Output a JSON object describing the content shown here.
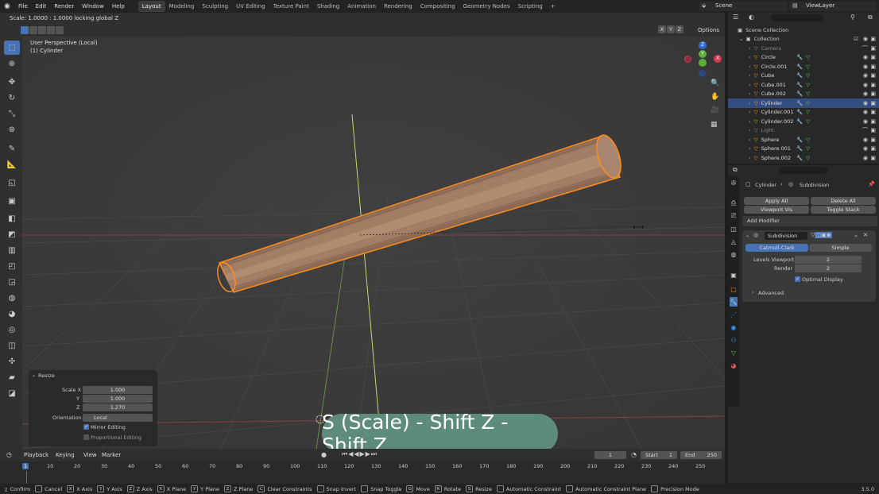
{
  "menu": [
    "File",
    "Edit",
    "Render",
    "Window",
    "Help"
  ],
  "workspaces": [
    "Layout",
    "Modeling",
    "Sculpting",
    "UV Editing",
    "Texture Paint",
    "Shading",
    "Animation",
    "Rendering",
    "Compositing",
    "Geometry Nodes",
    "Scripting"
  ],
  "add_workspace": "+",
  "scene": "Scene",
  "view_layer": "ViewLayer",
  "header_info": "Scale: 1.0000 : 1.0000 locking global Z",
  "axis_buttons": [
    "X",
    "Y",
    "Z"
  ],
  "options_label": "Options",
  "viewport": {
    "perspective": "User Perspective (Local)",
    "object": "(1) Cylinder"
  },
  "gizmo": {
    "z": "Z",
    "y": "Y",
    "x": "X"
  },
  "outliner": {
    "search_placeholder": "",
    "scene_collection": "Scene Collection",
    "collection": "Collection",
    "items": [
      {
        "name": "Camera",
        "dim": true
      },
      {
        "name": "Circle",
        "dim": false
      },
      {
        "name": "Circle.001",
        "dim": false
      },
      {
        "name": "Cube",
        "dim": false
      },
      {
        "name": "Cube.001",
        "dim": false
      },
      {
        "name": "Cube.002",
        "dim": false
      },
      {
        "name": "Cylinder",
        "dim": false,
        "selected": true
      },
      {
        "name": "Cylinder.001",
        "dim": false
      },
      {
        "name": "Cylinder.002",
        "dim": false
      },
      {
        "name": "Light",
        "dim": true
      },
      {
        "name": "Sphere",
        "dim": false
      },
      {
        "name": "Sphere.001",
        "dim": false
      },
      {
        "name": "Sphere.002",
        "dim": false
      }
    ]
  },
  "properties": {
    "breadcrumb_object": "Cylinder",
    "breadcrumb_modifier": "Subdivision",
    "apply_all": "Apply All",
    "delete_all": "Delete All",
    "viewport_vis": "Viewport Vis",
    "toggle_stack": "Toggle Stack",
    "add_modifier": "Add Modifier",
    "modifier_name": "Subdivision",
    "catmull_clark": "Catmull-Clark",
    "simple": "Simple",
    "levels_viewport_label": "Levels Viewport",
    "levels_viewport_value": "2",
    "render_label": "Render",
    "render_value": "2",
    "optimal_display": "Optimal Display",
    "advanced": "Advanced"
  },
  "resize_panel": {
    "title": "Resize",
    "scale_x_label": "Scale X",
    "scale_x": "1.000",
    "y_label": "Y",
    "y": "1.000",
    "z_label": "Z",
    "z": "1.270",
    "orientation_label": "Orientation",
    "orientation": "Local",
    "mirror_editing": "Mirror Editing",
    "proportional_editing": "Proportional Editing"
  },
  "tooltip": "S (Scale) - Shift Z - Shift Z",
  "timeline": {
    "menu": [
      "Playback",
      "Keying",
      "View",
      "Marker"
    ],
    "current_frame": "1",
    "start_label": "Start",
    "start": "1",
    "end_label": "End",
    "end": "250",
    "ticks": [
      "1",
      "10",
      "20",
      "30",
      "40",
      "50",
      "60",
      "70",
      "80",
      "90",
      "100",
      "110",
      "120",
      "130",
      "140",
      "150",
      "160",
      "170",
      "180",
      "190",
      "200",
      "210",
      "220",
      "230",
      "240",
      "250"
    ]
  },
  "status": [
    {
      "label": "Confirm"
    },
    {
      "key": "",
      "label": "Cancel"
    },
    {
      "key": "X",
      "label": "X Axis"
    },
    {
      "key": "Y",
      "label": "Y Axis"
    },
    {
      "key": "Z",
      "label": "Z Axis"
    },
    {
      "key": "X",
      "label": "X Plane"
    },
    {
      "key": "Y",
      "label": "Y Plane"
    },
    {
      "key": "Z",
      "label": "Z Plane"
    },
    {
      "key": "C",
      "label": "Clear Constraints"
    },
    {
      "key": "",
      "label": "Snap Invert"
    },
    {
      "key": "",
      "label": "Snap Toggle"
    },
    {
      "key": "G",
      "label": "Move"
    },
    {
      "key": "R",
      "label": "Rotate"
    },
    {
      "key": "S",
      "label": "Resize"
    },
    {
      "key": "",
      "label": "Automatic Constraint"
    },
    {
      "key": "",
      "label": "Automatic Constraint Plane"
    },
    {
      "key": "",
      "label": "Precision Mode"
    }
  ],
  "version": "3.5.0",
  "colors": {
    "accent": "#4772b3",
    "selection": "#ff8c1a",
    "tooltip": "#5e8c7b"
  }
}
